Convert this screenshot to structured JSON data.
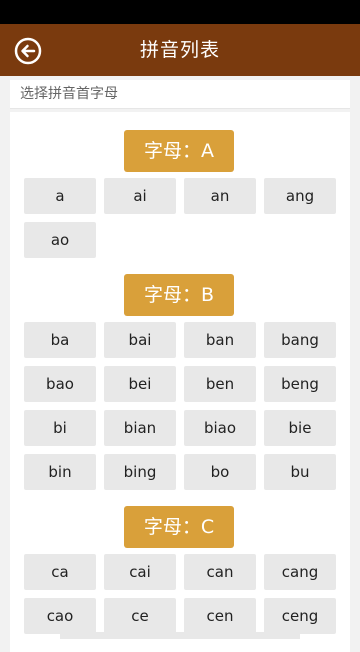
{
  "header": {
    "title": "拼音列表",
    "back_icon": "back-arrow-circle-icon"
  },
  "subheader": {
    "text": "选择拼音首字母"
  },
  "groups": [
    {
      "label": "字母：A",
      "items": [
        "a",
        "ai",
        "an",
        "ang",
        "ao"
      ]
    },
    {
      "label": "字母：B",
      "items": [
        "ba",
        "bai",
        "ban",
        "bang",
        "bao",
        "bei",
        "ben",
        "beng",
        "bi",
        "bian",
        "biao",
        "bie",
        "bin",
        "bing",
        "bo",
        "bu"
      ]
    },
    {
      "label": "字母：C",
      "items": [
        "ca",
        "cai",
        "can",
        "cang",
        "cao",
        "ce",
        "cen",
        "ceng"
      ]
    }
  ],
  "colors": {
    "header_bg": "#7a3a0e",
    "badge_bg": "#d9a03a",
    "chip_bg": "#e8e8e8",
    "page_bg": "#f2f2f2"
  }
}
